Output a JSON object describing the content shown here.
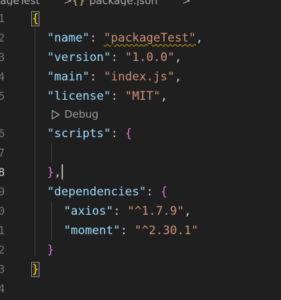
{
  "breadcrumb": {
    "project": "ageTest",
    "separator": ">",
    "file_icon": "{}",
    "file": "package.json",
    "separator_2": ">"
  },
  "line_numbers": [
    "1",
    "2",
    "3",
    "4",
    "5",
    "6",
    "7",
    "8",
    "9",
    "0",
    "1",
    "2",
    "3",
    "4"
  ],
  "active_line_number": "8",
  "codelens": {
    "label": "Debug",
    "icon": "run-triangle-icon"
  },
  "code": {
    "open_brace": "{",
    "name_key": "\"name\"",
    "name_value": "\"packageTest\"",
    "version_key": "\"version\"",
    "version_value": "\"1.0.0\"",
    "main_key": "\"main\"",
    "main_value": "\"index.js\"",
    "license_key": "\"license\"",
    "license_value": "\"MIT\"",
    "scripts_key": "\"scripts\"",
    "scripts_open": "{",
    "scripts_close": "}",
    "dependencies_key": "\"dependencies\"",
    "dependencies_open": "{",
    "axios_key": "\"axios\"",
    "axios_value": "\"^1.7.9\"",
    "moment_key": "\"moment\"",
    "moment_value": "\"^2.30.1\"",
    "dependencies_close": "}",
    "close_brace": "}",
    "colon": ": ",
    "comma": ","
  },
  "colors": {
    "background": "#1f1f1f",
    "key": "#9cdcfe",
    "string": "#ce9178",
    "brace_level_1": "#ffd700",
    "brace_level_2": "#da70d6",
    "brace_level_3": "#179fff",
    "warning_squiggle": "#cca700"
  }
}
